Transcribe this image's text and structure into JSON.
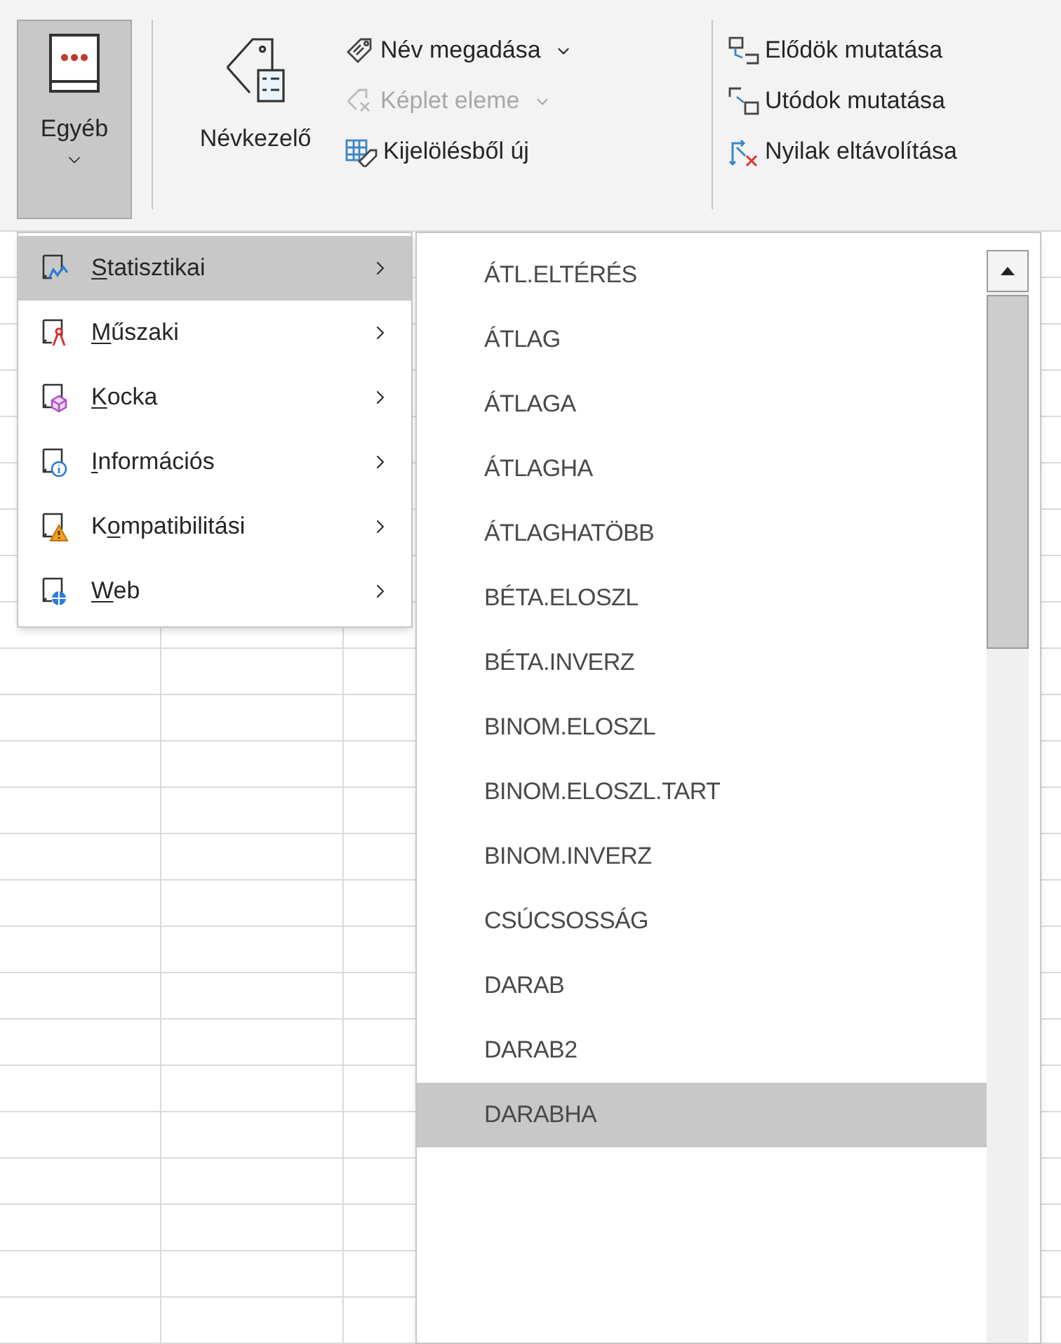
{
  "ribbon": {
    "other_button": {
      "label": "Egyéb",
      "selected": true
    },
    "name_manager": {
      "label": "Névkezelő"
    },
    "name_commands": [
      {
        "label": "Név megadása",
        "kind": "tag",
        "dropdown": true,
        "disabled": false
      },
      {
        "label": "Képlet eleme",
        "kind": "formula",
        "dropdown": true,
        "disabled": true
      },
      {
        "label": "Kijelölésből új",
        "kind": "table",
        "dropdown": false,
        "disabled": false
      }
    ],
    "audit_commands": [
      {
        "label": "Elődök mutatása",
        "kind": "precedents"
      },
      {
        "label": "Utódok mutatása",
        "kind": "dependents"
      },
      {
        "label": "Nyilak eltávolítása",
        "kind": "remove"
      }
    ]
  },
  "menu": {
    "items": [
      {
        "label_segments": [
          {
            "text": "S",
            "underlined": true
          },
          {
            "text": "tatisztikai",
            "underlined": false
          }
        ],
        "kind": "chart",
        "selected": true
      },
      {
        "label_segments": [
          {
            "text": "M",
            "underlined": true
          },
          {
            "text": "űszaki",
            "underlined": false
          }
        ],
        "kind": "compass",
        "selected": false
      },
      {
        "label_segments": [
          {
            "text": "K",
            "underlined": true
          },
          {
            "text": "ocka",
            "underlined": false
          }
        ],
        "kind": "cube",
        "selected": false
      },
      {
        "label_segments": [
          {
            "text": "I",
            "underlined": true
          },
          {
            "text": "nformációs",
            "underlined": false
          }
        ],
        "kind": "info",
        "selected": false
      },
      {
        "label_segments": [
          {
            "text": "K",
            "underlined": false
          },
          {
            "text": "o",
            "underlined": true
          },
          {
            "text": "mpatibilitási",
            "underlined": false
          }
        ],
        "kind": "warning",
        "selected": false
      },
      {
        "label_segments": [
          {
            "text": "W",
            "underlined": true
          },
          {
            "text": "eb",
            "underlined": false
          }
        ],
        "kind": "globe",
        "selected": false
      }
    ]
  },
  "submenu": {
    "items": [
      {
        "label": "ÁTL.ELTÉRÉS",
        "selected": false
      },
      {
        "label": "ÁTLAG",
        "selected": false
      },
      {
        "label": "ÁTLAGA",
        "selected": false
      },
      {
        "label": "ÁTLAGHA",
        "selected": false
      },
      {
        "label": "ÁTLAGHATÖBB",
        "selected": false
      },
      {
        "label": "BÉTA.ELOSZL",
        "selected": false
      },
      {
        "label": "BÉTA.INVERZ",
        "selected": false
      },
      {
        "label": "BINOM.ELOSZL",
        "selected": false
      },
      {
        "label": "BINOM.ELOSZL.TART",
        "selected": false
      },
      {
        "label": "BINOM.INVERZ",
        "selected": false
      },
      {
        "label": "CSÚCSOSSÁG",
        "selected": false
      },
      {
        "label": "DARAB",
        "selected": false
      },
      {
        "label": "DARAB2",
        "selected": false
      },
      {
        "label": "DARABHA",
        "selected": true
      }
    ]
  }
}
